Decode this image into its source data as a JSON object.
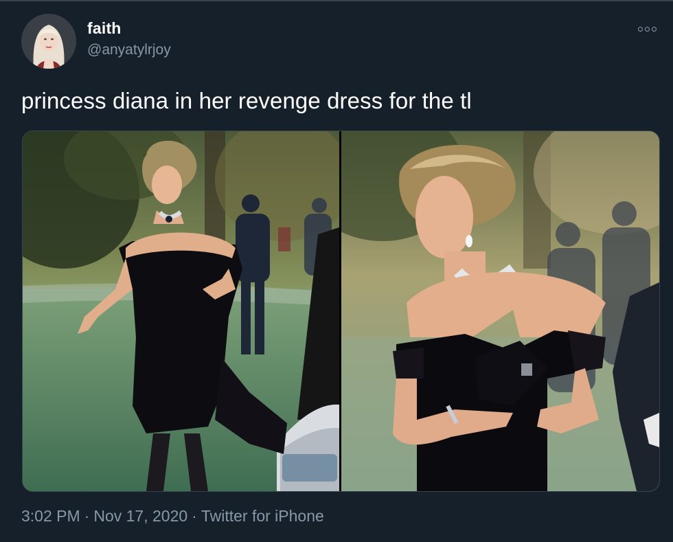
{
  "user": {
    "display_name": "faith",
    "handle": "@anyatylrjoy"
  },
  "tweet": {
    "text": "princess diana in her revenge dress for the tl"
  },
  "meta": {
    "time": "3:02 PM",
    "date": "Nov 17, 2020",
    "separator": "·",
    "source": "Twitter for iPhone"
  },
  "colors": {
    "background": "#15202b",
    "secondary_text": "#8899a6",
    "border": "#38444d"
  },
  "icons": {
    "more": "more-options-icon"
  }
}
